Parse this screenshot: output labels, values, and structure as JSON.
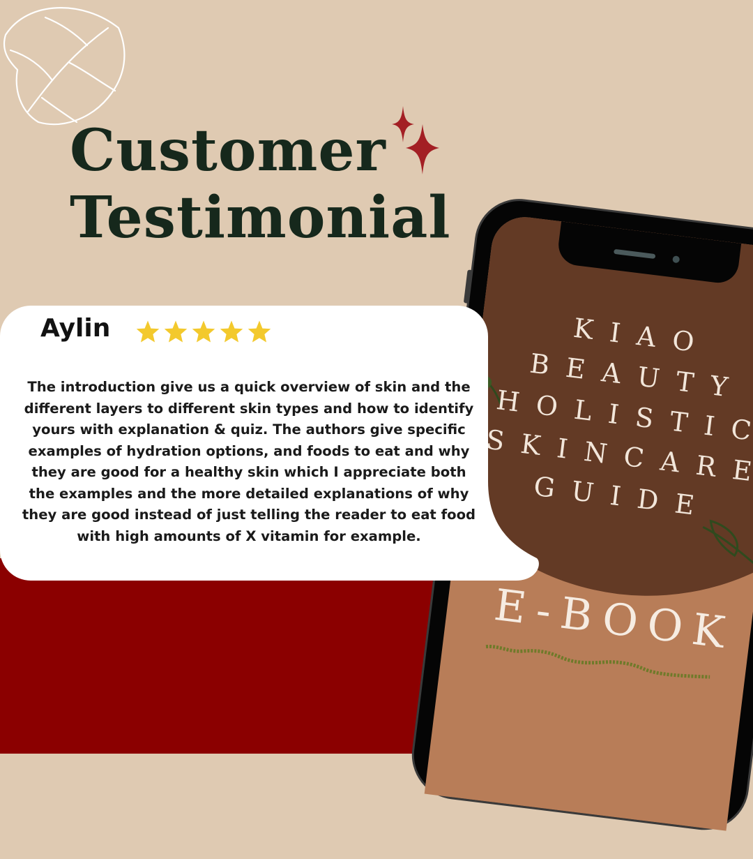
{
  "header": {
    "title_line1": "Customer",
    "title_line2": "Testimonial"
  },
  "testimonial": {
    "name": "Aylin",
    "rating": 5,
    "rating_max": 5,
    "text": "The introduction give us a quick overview of skin and the different layers to different skin types and how to identify yours with explanation & quiz. The authors give specific examples of hydration options, and foods to eat and why they are good for a healthy skin which I appreciate both the examples and the more detailed explanations of why they are good instead of just telling the reader to eat food with high amounts of X vitamin for example."
  },
  "phone_screen": {
    "book_title_lines": [
      "KIAO",
      "BEAUTY",
      "HOLISTIC",
      "SKINCARE",
      "GUIDE"
    ],
    "ebook_label": "E-BOOK"
  },
  "colors": {
    "background_top": "#dfcab2",
    "background_bottom": "#8b0000",
    "title_color": "#16281c",
    "sparkle_color": "#a31f24",
    "star_color": "#f3c92d",
    "screen_dark_brown": "#633a25",
    "screen_light_brown": "#b87d58"
  },
  "icons": [
    "monstera-leaf-outline-icon",
    "sparkle-icon",
    "star-icon"
  ]
}
